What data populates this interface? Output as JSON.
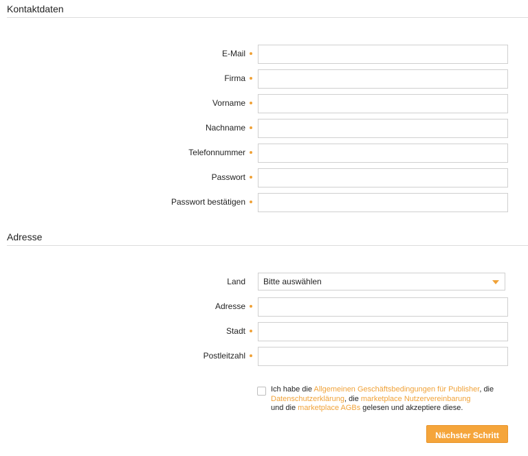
{
  "contact": {
    "title": "Kontaktdaten",
    "fields": [
      {
        "label": "E-Mail",
        "value": ""
      },
      {
        "label": "Firma",
        "value": ""
      },
      {
        "label": "Vorname",
        "value": ""
      },
      {
        "label": "Nachname",
        "value": ""
      },
      {
        "label": "Telefonnummer",
        "value": ""
      },
      {
        "label": "Passwort",
        "value": ""
      },
      {
        "label": "Passwort bestätigen",
        "value": ""
      }
    ]
  },
  "address": {
    "title": "Adresse",
    "country": {
      "label": "Land",
      "selected": "Bitte auswählen"
    },
    "fields": [
      {
        "label": "Adresse",
        "value": ""
      },
      {
        "label": "Stadt",
        "value": ""
      },
      {
        "label": "Postleitzahl",
        "value": ""
      }
    ]
  },
  "consent": {
    "t1": "Ich habe die ",
    "link1": "Allgemeinen Geschäftsbedingungen für Publisher",
    "t2": ", die ",
    "link2": "Datenschutzerklärung",
    "t3": ", die ",
    "link3": "marketplace Nutzervereinbarung",
    "t4": " und die ",
    "link4": "marketplace AGBs",
    "t5": " gelesen und akzeptiere diese.",
    "checked": false
  },
  "actions": {
    "next_label": "Nächster Schritt"
  },
  "colors": {
    "accent": "#f0a238",
    "button": "#f5a53b"
  }
}
